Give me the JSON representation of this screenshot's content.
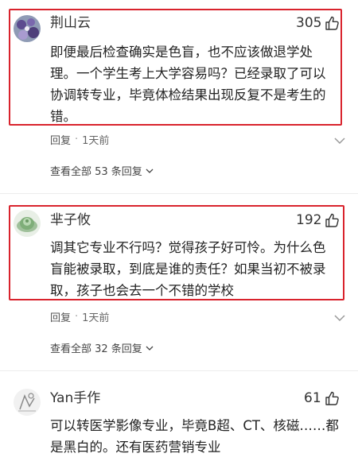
{
  "comments": [
    {
      "username": "荆山云",
      "likes": "305",
      "lines": [
        "即便最后检查确实是色盲，也不应该做退学处",
        "理。一个学生考上大学容易吗？已经录取了可以",
        "协调转专业，毕竟体检结果出现反复不是考生的",
        "错。"
      ],
      "reply_label": "回复",
      "dot": "·",
      "time": "1天前",
      "view_replies": "查看全部 53 条回复"
    },
    {
      "username": "芈子攸",
      "likes": "192",
      "lines": [
        "调其它专业不行吗？觉得孩子好可怜。为什么色",
        "盲能被录取，到底是谁的责任？如果当初不被录",
        "取，孩子也会去一个不错的学校"
      ],
      "reply_label": "回复",
      "dot": "·",
      "time": "1天前",
      "view_replies": "查看全部 32 条回复"
    },
    {
      "username": "Yan手作",
      "likes": "61",
      "lines": [
        "可以转医学影像专业，毕竟B超、CT、核磁……都",
        "是黑白的。还有医药营销专业"
      ]
    }
  ],
  "colors": {
    "highlight": "#d9232d",
    "text": "#222222",
    "meta": "#666666"
  },
  "icons": [
    "thumbs-up-icon",
    "more-options-icon",
    "chevron-down-icon"
  ]
}
